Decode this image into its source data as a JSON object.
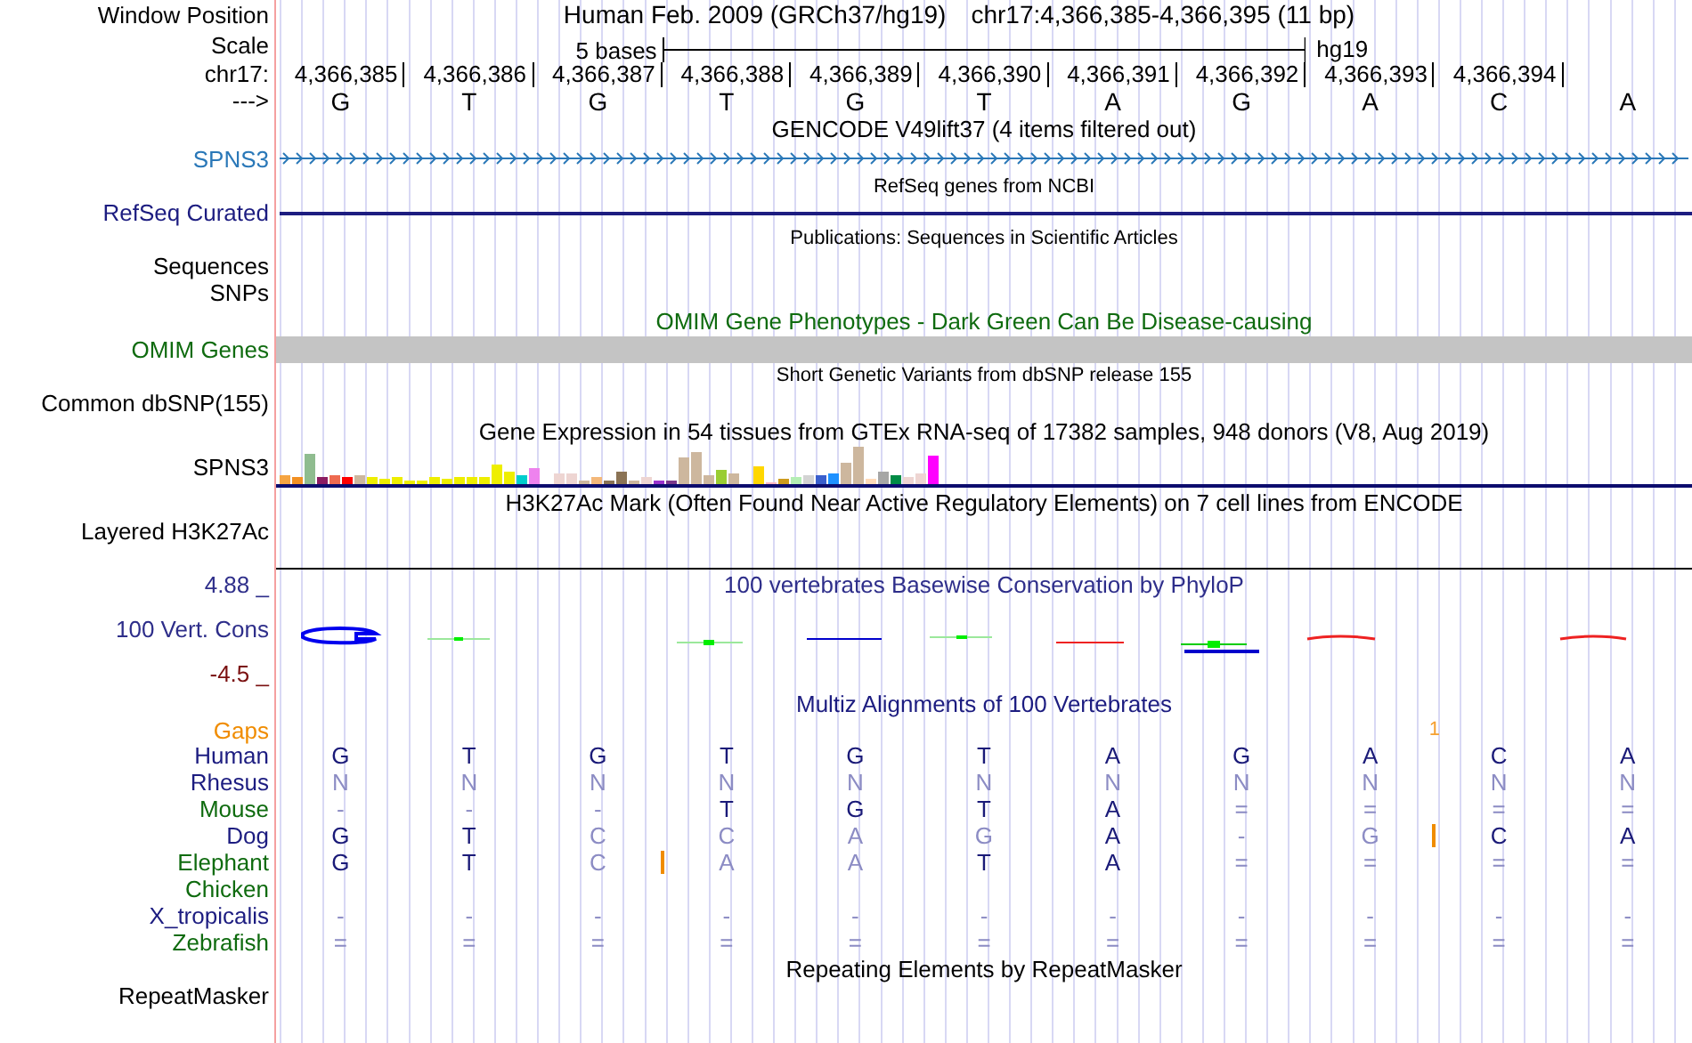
{
  "header": {
    "label": "Window Position",
    "title": "Human Feb. 2009 (GRCh37/hg19)",
    "position": "chr17:4,366,385-4,366,395 (11 bp)"
  },
  "scale": {
    "label": "Scale",
    "span": "5 bases",
    "assembly": "hg19"
  },
  "ruler": {
    "label": "chr17:",
    "positions": [
      "4,366,385",
      "4,366,386",
      "4,366,387",
      "4,366,388",
      "4,366,389",
      "4,366,390",
      "4,366,391",
      "4,366,392",
      "4,366,393",
      "4,366,394"
    ]
  },
  "sequence": {
    "label": "--->",
    "bases": [
      "G",
      "T",
      "G",
      "T",
      "G",
      "T",
      "A",
      "G",
      "A",
      "C",
      "A"
    ]
  },
  "tracks": [
    {
      "kind": "gene",
      "title": "GENCODE V49lift37 (4 items filtered out)",
      "labels": [
        "SPNS3"
      ],
      "color": "#2a78b8"
    },
    {
      "kind": "line",
      "title": "RefSeq genes from NCBI",
      "labels": [
        "RefSeq Curated"
      ],
      "color": "#1c1c80"
    },
    {
      "kind": "empty",
      "title": "Publications: Sequences in Scientific Articles",
      "labels": [
        "Sequences",
        "SNPs"
      ],
      "color": "#000000"
    },
    {
      "kind": "bar",
      "title": "OMIM Gene Phenotypes - Dark Green Can Be Disease-causing",
      "labels": [
        "OMIM Genes"
      ],
      "color": "#0f6b0f"
    },
    {
      "kind": "empty",
      "title": "Short Genetic Variants from dbSNP release 155",
      "labels": [
        "Common dbSNP(155)"
      ],
      "color": "#000000"
    },
    {
      "kind": "expression",
      "title": "Gene Expression in 54 tissues from GTEx RNA-seq of 17382 samples, 948 donors (V8, Aug 2019)",
      "labels": [
        "SPNS3"
      ],
      "color": "#000000"
    },
    {
      "kind": "signal",
      "title": "H3K27Ac Mark (Often Found Near Active Regulatory Elements) on 7 cell lines from ENCODE",
      "labels": [
        "Layered H3K27Ac"
      ],
      "color": "#000000"
    },
    {
      "kind": "conservation",
      "title": "100 vertebrates Basewise Conservation by PhyloP",
      "labels": [
        "100 Vert. Cons"
      ],
      "color": "#2e2e8a",
      "max_label": "4.88 _",
      "min_label": "-4.5 _"
    },
    {
      "kind": "alignment",
      "title": "Multiz Alignments of 100 Vertebrates",
      "color": "#1c1c80",
      "gaps": {
        "label": "Gaps"
      },
      "species": [
        {
          "name": "Human",
          "color": "#1c1c80",
          "cells": [
            {
              "base": "G",
              "match": true
            },
            {
              "base": "T",
              "match": true
            },
            {
              "base": "G",
              "match": true
            },
            {
              "base": "T",
              "match": true
            },
            {
              "base": "G",
              "match": true
            },
            {
              "base": "T",
              "match": true
            },
            {
              "base": "A",
              "match": true
            },
            {
              "base": "G",
              "match": true
            },
            {
              "base": "A",
              "match": true
            },
            {
              "base": "C",
              "match": true
            },
            {
              "base": "A",
              "match": true
            }
          ]
        },
        {
          "name": "Rhesus",
          "color": "#1c1c80",
          "cells": [
            {
              "base": "N",
              "match": false
            },
            {
              "base": "N",
              "match": false
            },
            {
              "base": "N",
              "match": false
            },
            {
              "base": "N",
              "match": false
            },
            {
              "base": "N",
              "match": false
            },
            {
              "base": "N",
              "match": false
            },
            {
              "base": "N",
              "match": false
            },
            {
              "base": "N",
              "match": false
            },
            {
              "base": "N",
              "match": false
            },
            {
              "base": "N",
              "match": false
            },
            {
              "base": "N",
              "match": false
            }
          ]
        },
        {
          "name": "Mouse",
          "color": "#0f6b0f",
          "cells": [
            {
              "base": "-",
              "match": false
            },
            {
              "base": "-",
              "match": false
            },
            {
              "base": "-",
              "match": false
            },
            {
              "base": "T",
              "match": true
            },
            {
              "base": "G",
              "match": true
            },
            {
              "base": "T",
              "match": true
            },
            {
              "base": "A",
              "match": true
            },
            {
              "base": "=",
              "match": false
            },
            {
              "base": "=",
              "match": false
            },
            {
              "base": "=",
              "match": false
            },
            {
              "base": "=",
              "match": false
            }
          ]
        },
        {
          "name": "Dog",
          "color": "#1c1c80",
          "cells": [
            {
              "base": "G",
              "match": true,
              "insertion_after": false
            },
            {
              "base": "T",
              "match": true,
              "insertion_after": false
            },
            {
              "base": "C",
              "match": false,
              "insertion_after": false
            },
            {
              "base": "C",
              "match": false,
              "insertion_after": false
            },
            {
              "base": "A",
              "match": false,
              "insertion_after": false
            },
            {
              "base": "G",
              "match": false,
              "insertion_after": false
            },
            {
              "base": "A",
              "match": true,
              "insertion_after": false
            },
            {
              "base": "-",
              "match": false,
              "insertion_after": false
            },
            {
              "base": "G",
              "match": false,
              "insertion_after": true,
              "gap_count": "1"
            },
            {
              "base": "C",
              "match": true,
              "insertion_after": false
            },
            {
              "base": "A",
              "match": true,
              "insertion_after": false
            }
          ]
        },
        {
          "name": "Elephant",
          "color": "#0f6b0f",
          "cells": [
            {
              "base": "G",
              "match": true,
              "insertion_after": false
            },
            {
              "base": "T",
              "match": true,
              "insertion_after": false
            },
            {
              "base": "C",
              "match": false,
              "insertion_after": true
            },
            {
              "base": "A",
              "match": false,
              "insertion_after": false
            },
            {
              "base": "A",
              "match": false,
              "insertion_after": false
            },
            {
              "base": "T",
              "match": true,
              "insertion_after": false
            },
            {
              "base": "A",
              "match": true,
              "insertion_after": false
            },
            {
              "base": "=",
              "match": false,
              "insertion_after": false
            },
            {
              "base": "=",
              "match": false,
              "insertion_after": false
            },
            {
              "base": "=",
              "match": false,
              "insertion_after": false
            },
            {
              "base": "=",
              "match": false,
              "insertion_after": false
            }
          ]
        },
        {
          "name": "Chicken",
          "color": "#0f6b0f"
        },
        {
          "name": "X_tropicalis",
          "color": "#1c1c80",
          "cells": [
            {
              "base": "-",
              "match": false
            },
            {
              "base": "-",
              "match": false
            },
            {
              "base": "-",
              "match": false
            },
            {
              "base": "-",
              "match": false
            },
            {
              "base": "-",
              "match": false
            },
            {
              "base": "-",
              "match": false
            },
            {
              "base": "-",
              "match": false
            },
            {
              "base": "-",
              "match": false
            },
            {
              "base": "-",
              "match": false
            },
            {
              "base": "-",
              "match": false
            },
            {
              "base": "-",
              "match": false
            }
          ]
        },
        {
          "name": "Zebrafish",
          "color": "#0f6b0f",
          "cells": [
            {
              "base": "=",
              "match": false
            },
            {
              "base": "=",
              "match": false
            },
            {
              "base": "=",
              "match": false
            },
            {
              "base": "=",
              "match": false
            },
            {
              "base": "=",
              "match": false
            },
            {
              "base": "=",
              "match": false
            },
            {
              "base": "=",
              "match": false
            },
            {
              "base": "=",
              "match": false
            },
            {
              "base": "=",
              "match": false
            },
            {
              "base": "=",
              "match": false
            },
            {
              "base": "=",
              "match": false
            }
          ]
        }
      ]
    },
    {
      "kind": "repeat",
      "title": "Repeating Elements by RepeatMasker",
      "labels": [
        "RepeatMasker"
      ],
      "color": "#000000"
    }
  ]
}
